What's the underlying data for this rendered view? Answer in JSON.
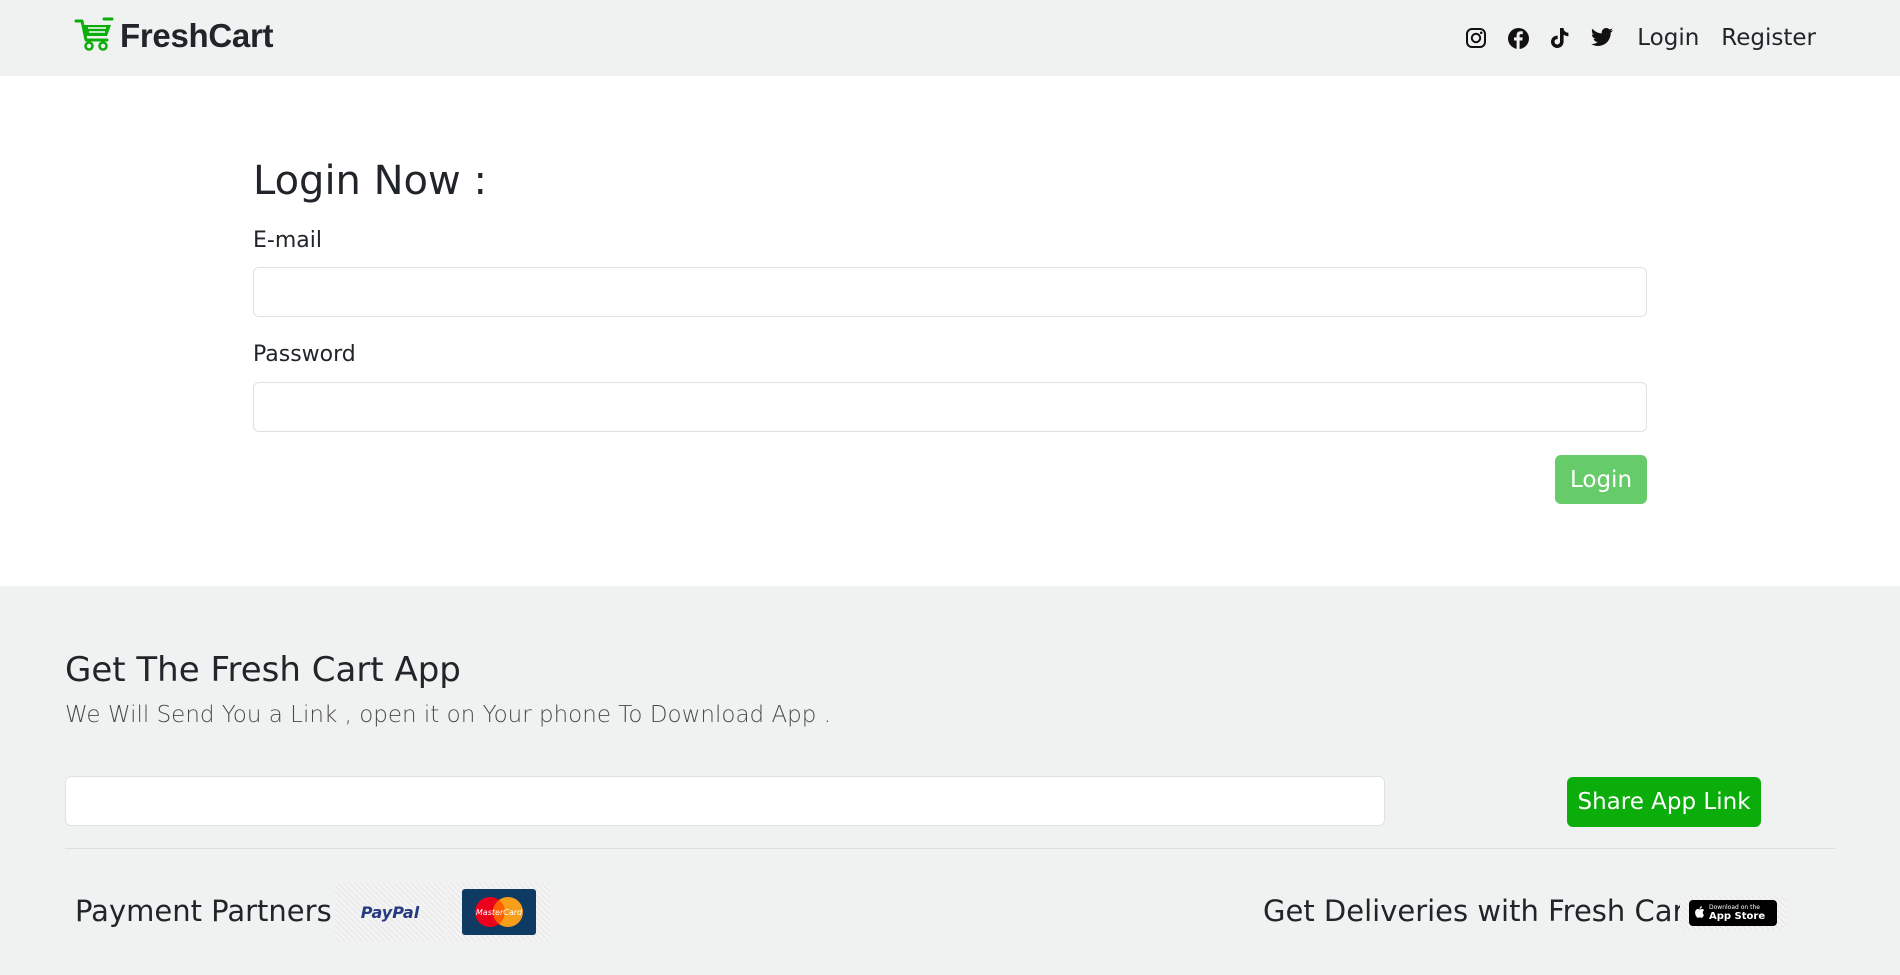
{
  "navbar": {
    "brand": "FreshCart",
    "social": [
      "instagram-icon",
      "facebook-icon",
      "tiktok-icon",
      "twitter-icon"
    ],
    "links": {
      "login": "Login",
      "register": "Register"
    }
  },
  "login": {
    "title": "Login Now :",
    "email_label": "E-mail",
    "email_value": "",
    "password_label": "Password",
    "password_value": "",
    "button": "Login"
  },
  "footer": {
    "title": "Get The Fresh Cart App",
    "subtitle": "We Will Send You a Link , open it on Your phone To Download App .",
    "email_value": "",
    "share_button": "Share App Link",
    "payment_label": "Payment Partners",
    "payment_partners": [
      "PayPal",
      "MasterCard"
    ],
    "deliveries_label": "Get Deliveries with Fresh Cart",
    "appstore_small": "Download on the",
    "appstore_big": "App Store"
  },
  "colors": {
    "brand_green": "#0aad0a",
    "login_button": "#66cc6a",
    "navbar_bg": "#f0f2f1"
  }
}
